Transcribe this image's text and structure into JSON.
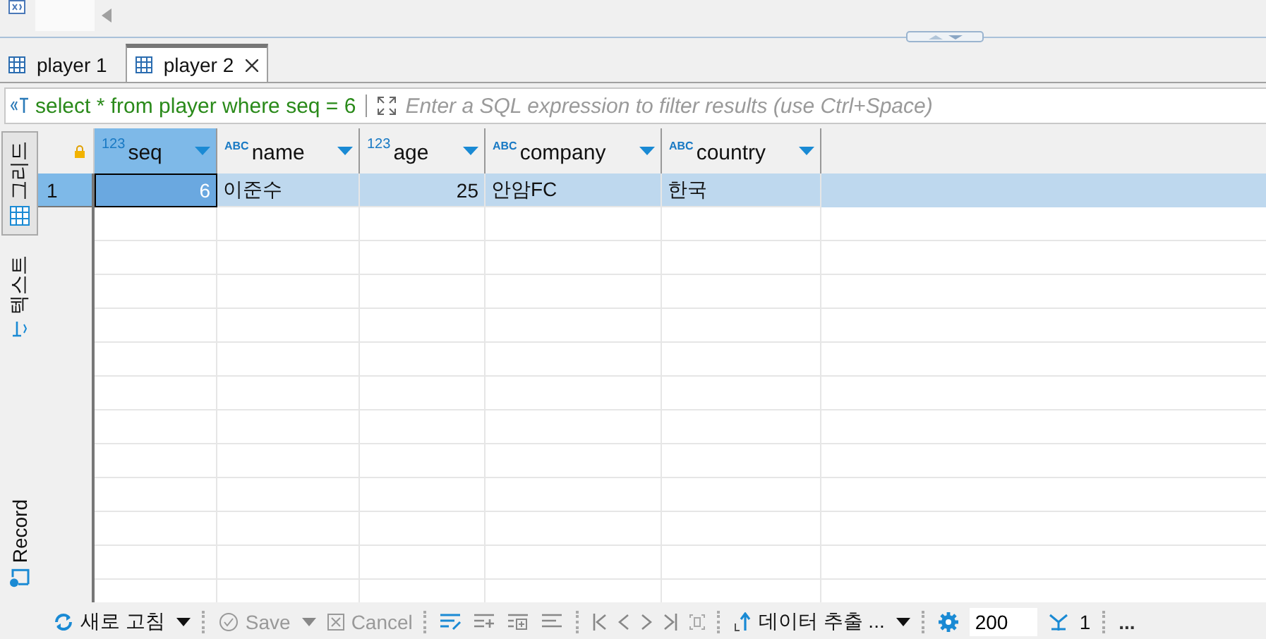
{
  "editor_tabs": [
    {
      "label": "player 1",
      "selected": false
    },
    {
      "label": "player 2",
      "selected": true
    }
  ],
  "filter": {
    "query": "select * from player where seq = 6",
    "placeholder": "Enter a SQL expression to filter results (use Ctrl+Space)"
  },
  "view_tabs": [
    {
      "kind": "grid",
      "label": "그리드",
      "selected": true
    },
    {
      "kind": "text",
      "label": "텍스트",
      "selected": false
    },
    {
      "kind": "record",
      "label": "Record",
      "selected": false
    }
  ],
  "table": {
    "columns": [
      {
        "name": "seq",
        "type_label": "123",
        "kind": "number",
        "selected": true
      },
      {
        "name": "name",
        "type_label": "ABC",
        "kind": "text",
        "selected": false
      },
      {
        "name": "age",
        "type_label": "123",
        "kind": "number",
        "selected": false
      },
      {
        "name": "company",
        "type_label": "ABC",
        "kind": "text",
        "selected": false
      },
      {
        "name": "country",
        "type_label": "ABC",
        "kind": "text",
        "selected": false
      }
    ],
    "rows": [
      {
        "number": "1",
        "selected": true,
        "cells": [
          {
            "value": "6",
            "focused": true
          },
          {
            "value": "이준수",
            "focused": false
          },
          {
            "value": "25",
            "focused": false
          },
          {
            "value": "안암FC",
            "focused": false
          },
          {
            "value": "한국",
            "focused": false
          }
        ]
      }
    ]
  },
  "toolbar": {
    "refresh": "새로 고침",
    "save": {
      "label": "Save",
      "disabled": true
    },
    "cancel": {
      "label": "Cancel",
      "disabled": true
    },
    "export": "데이터 추출 ...",
    "fetch_size": "200",
    "fetch_count": "1",
    "more": "..."
  }
}
